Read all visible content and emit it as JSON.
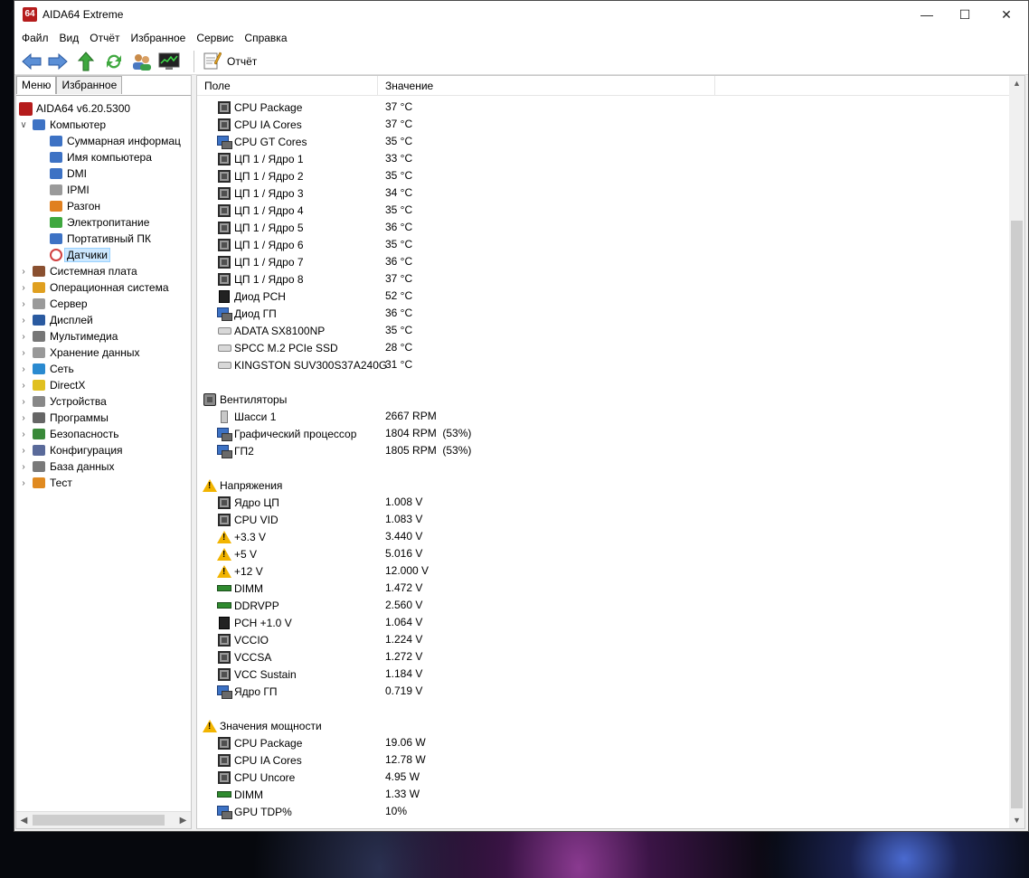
{
  "window": {
    "title": "AIDA64 Extreme",
    "logo": "64",
    "controls": {
      "minimize": "—",
      "maximize": "☐",
      "close": "✕"
    }
  },
  "menu": [
    "Файл",
    "Вид",
    "Отчёт",
    "Избранное",
    "Сервис",
    "Справка"
  ],
  "toolbar": {
    "icons": [
      "back-arrow-icon",
      "forward-arrow-icon",
      "up-arrow-icon",
      "refresh-icon",
      "users-icon",
      "monitor-graph-icon"
    ],
    "report_label": "Отчёт"
  },
  "left_panel": {
    "tabs": [
      "Меню",
      "Избранное"
    ],
    "tree": [
      {
        "label": "AIDA64 v6.20.5300",
        "level": 0,
        "expander": "",
        "icon": "aida64-logo-icon"
      },
      {
        "label": "Компьютер",
        "level": 0,
        "expander": "v",
        "icon": "computer-icon"
      },
      {
        "label": "Суммарная информац",
        "level": 1,
        "expander": "",
        "icon": "computer-icon"
      },
      {
        "label": "Имя компьютера",
        "level": 1,
        "expander": "",
        "icon": "computer-icon"
      },
      {
        "label": "DMI",
        "level": 1,
        "expander": "",
        "icon": "computer-icon"
      },
      {
        "label": "IPMI",
        "level": 1,
        "expander": "",
        "icon": "server-icon"
      },
      {
        "label": "Разгон",
        "level": 1,
        "expander": "",
        "icon": "flame-icon"
      },
      {
        "label": "Электропитание",
        "level": 1,
        "expander": "",
        "icon": "power-icon"
      },
      {
        "label": "Портативный ПК",
        "level": 1,
        "expander": "",
        "icon": "laptop-icon"
      },
      {
        "label": "Датчики",
        "level": 1,
        "expander": "",
        "icon": "gauge-icon",
        "selected": true
      },
      {
        "label": "Системная плата",
        "level": 0,
        "expander": ">",
        "icon": "motherboard-icon"
      },
      {
        "label": "Операционная система",
        "level": 0,
        "expander": ">",
        "icon": "windows-icon"
      },
      {
        "label": "Сервер",
        "level": 0,
        "expander": ">",
        "icon": "server-icon"
      },
      {
        "label": "Дисплей",
        "level": 0,
        "expander": ">",
        "icon": "display-icon"
      },
      {
        "label": "Мультимедиа",
        "level": 0,
        "expander": ">",
        "icon": "speaker-icon"
      },
      {
        "label": "Хранение данных",
        "level": 0,
        "expander": ">",
        "icon": "storage-icon"
      },
      {
        "label": "Сеть",
        "level": 0,
        "expander": ">",
        "icon": "network-icon"
      },
      {
        "label": "DirectX",
        "level": 0,
        "expander": ">",
        "icon": "directx-icon"
      },
      {
        "label": "Устройства",
        "level": 0,
        "expander": ">",
        "icon": "devices-icon"
      },
      {
        "label": "Программы",
        "level": 0,
        "expander": ">",
        "icon": "programs-icon"
      },
      {
        "label": "Безопасность",
        "level": 0,
        "expander": ">",
        "icon": "shield-icon"
      },
      {
        "label": "Конфигурация",
        "level": 0,
        "expander": ">",
        "icon": "config-icon"
      },
      {
        "label": "База данных",
        "level": 0,
        "expander": ">",
        "icon": "database-icon"
      },
      {
        "label": "Тест",
        "level": 0,
        "expander": ">",
        "icon": "benchmark-icon"
      }
    ]
  },
  "columns": {
    "field": "Поле",
    "value": "Значение"
  },
  "rows": [
    {
      "type": "item",
      "icon": "cpu-chip-icon",
      "field": "CPU Package",
      "value": "37 °C"
    },
    {
      "type": "item",
      "icon": "cpu-chip-icon",
      "field": "CPU IA Cores",
      "value": "37 °C"
    },
    {
      "type": "item",
      "icon": "gpu-icon",
      "field": "CPU GT Cores",
      "value": "35 °C"
    },
    {
      "type": "item",
      "icon": "cpu-chip-icon",
      "field": "ЦП 1 / Ядро 1",
      "value": "33 °C"
    },
    {
      "type": "item",
      "icon": "cpu-chip-icon",
      "field": "ЦП 1 / Ядро 2",
      "value": "35 °C"
    },
    {
      "type": "item",
      "icon": "cpu-chip-icon",
      "field": "ЦП 1 / Ядро 3",
      "value": "34 °C"
    },
    {
      "type": "item",
      "icon": "cpu-chip-icon",
      "field": "ЦП 1 / Ядро 4",
      "value": "35 °C"
    },
    {
      "type": "item",
      "icon": "cpu-chip-icon",
      "field": "ЦП 1 / Ядро 5",
      "value": "36 °C"
    },
    {
      "type": "item",
      "icon": "cpu-chip-icon",
      "field": "ЦП 1 / Ядро 6",
      "value": "35 °C"
    },
    {
      "type": "item",
      "icon": "cpu-chip-icon",
      "field": "ЦП 1 / Ядро 7",
      "value": "36 °C"
    },
    {
      "type": "item",
      "icon": "cpu-chip-icon",
      "field": "ЦП 1 / Ядро 8",
      "value": "37 °C"
    },
    {
      "type": "item",
      "icon": "pch-chip-icon",
      "field": "Диод PCH",
      "value": "52 °C"
    },
    {
      "type": "item",
      "icon": "gpu-icon",
      "field": "Диод ГП",
      "value": "36 °C"
    },
    {
      "type": "item",
      "icon": "disk-icon",
      "field": "ADATA SX8100NP",
      "value": "35 °C"
    },
    {
      "type": "item",
      "icon": "disk-icon",
      "field": "SPCC M.2 PCIe SSD",
      "value": "28 °C"
    },
    {
      "type": "item",
      "icon": "disk-icon",
      "field": "KINGSTON SUV300S37A240G",
      "value": "31 °C"
    },
    {
      "type": "blank"
    },
    {
      "type": "group",
      "icon": "fan-icon",
      "field": "Вентиляторы",
      "value": ""
    },
    {
      "type": "item",
      "icon": "case-icon",
      "field": "Шасси 1",
      "value": "2667 RPM"
    },
    {
      "type": "item",
      "icon": "gpu-icon",
      "field": "Графический процессор",
      "value": "1804 RPM  (53%)"
    },
    {
      "type": "item",
      "icon": "gpu-icon",
      "field": "ГП2",
      "value": "1805 RPM  (53%)"
    },
    {
      "type": "blank"
    },
    {
      "type": "group",
      "icon": "warning-icon",
      "field": "Напряжения",
      "value": ""
    },
    {
      "type": "item",
      "icon": "cpu-chip-icon",
      "field": "Ядро ЦП",
      "value": "1.008 V"
    },
    {
      "type": "item",
      "icon": "cpu-chip-icon",
      "field": "CPU VID",
      "value": "1.083 V"
    },
    {
      "type": "item",
      "icon": "warning-icon",
      "field": "+3.3 V",
      "value": "3.440 V"
    },
    {
      "type": "item",
      "icon": "warning-icon",
      "field": "+5 V",
      "value": "5.016 V"
    },
    {
      "type": "item",
      "icon": "warning-icon",
      "field": "+12 V",
      "value": "12.000 V"
    },
    {
      "type": "item",
      "icon": "ram-icon",
      "field": "DIMM",
      "value": "1.472 V"
    },
    {
      "type": "item",
      "icon": "ram-icon",
      "field": "DDRVPP",
      "value": "2.560 V"
    },
    {
      "type": "item",
      "icon": "pch-chip-icon",
      "field": "PCH +1.0 V",
      "value": "1.064 V"
    },
    {
      "type": "item",
      "icon": "cpu-chip-icon",
      "field": "VCCIO",
      "value": "1.224 V"
    },
    {
      "type": "item",
      "icon": "cpu-chip-icon",
      "field": "VCCSA",
      "value": "1.272 V"
    },
    {
      "type": "item",
      "icon": "cpu-chip-icon",
      "field": "VCC Sustain",
      "value": "1.184 V"
    },
    {
      "type": "item",
      "icon": "gpu-icon",
      "field": "Ядро ГП",
      "value": "0.719 V"
    },
    {
      "type": "blank"
    },
    {
      "type": "group",
      "icon": "warning-icon",
      "field": "Значения мощности",
      "value": ""
    },
    {
      "type": "item",
      "icon": "cpu-chip-icon",
      "field": "CPU Package",
      "value": "19.06 W"
    },
    {
      "type": "item",
      "icon": "cpu-chip-icon",
      "field": "CPU IA Cores",
      "value": "12.78 W"
    },
    {
      "type": "item",
      "icon": "cpu-chip-icon",
      "field": "CPU Uncore",
      "value": "4.95 W"
    },
    {
      "type": "item",
      "icon": "ram-icon",
      "field": "DIMM",
      "value": "1.33 W"
    },
    {
      "type": "item",
      "icon": "gpu-icon",
      "field": "GPU TDP%",
      "value": "10%"
    }
  ]
}
